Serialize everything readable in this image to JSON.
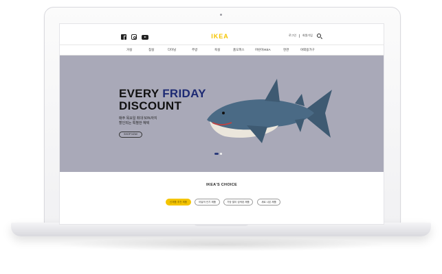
{
  "header": {
    "logo_text": "IKEA",
    "login": "로그인",
    "signup": "회원가입"
  },
  "nav": [
    "거실",
    "침실",
    "다이닝",
    "주방",
    "욕실",
    "홈오피스",
    "어린이IKEA",
    "현관",
    "야외용가구"
  ],
  "hero": {
    "title_line1_prefix": "EVERY ",
    "title_line1_highlight": "FRIDAY",
    "title_line2": "DISCOUNT",
    "subtitle_line1": "매주 목요일 최대 50%까지",
    "subtitle_line2": "할인되는 특별한 혜택",
    "button": "SHOP NOW",
    "slide_index": 1,
    "slide_count": 2
  },
  "choice": {
    "title": "IKEA'S CHOICE",
    "tabs": [
      "신제품 추천 제품",
      "이달의 인기 제품",
      "가장 많이 검색된 제품",
      "새로 나온 제품"
    ]
  },
  "colors": {
    "brand_yellow": "#f4c400",
    "hero_bg": "#a9a9b8",
    "highlight_blue": "#1d2a73"
  }
}
